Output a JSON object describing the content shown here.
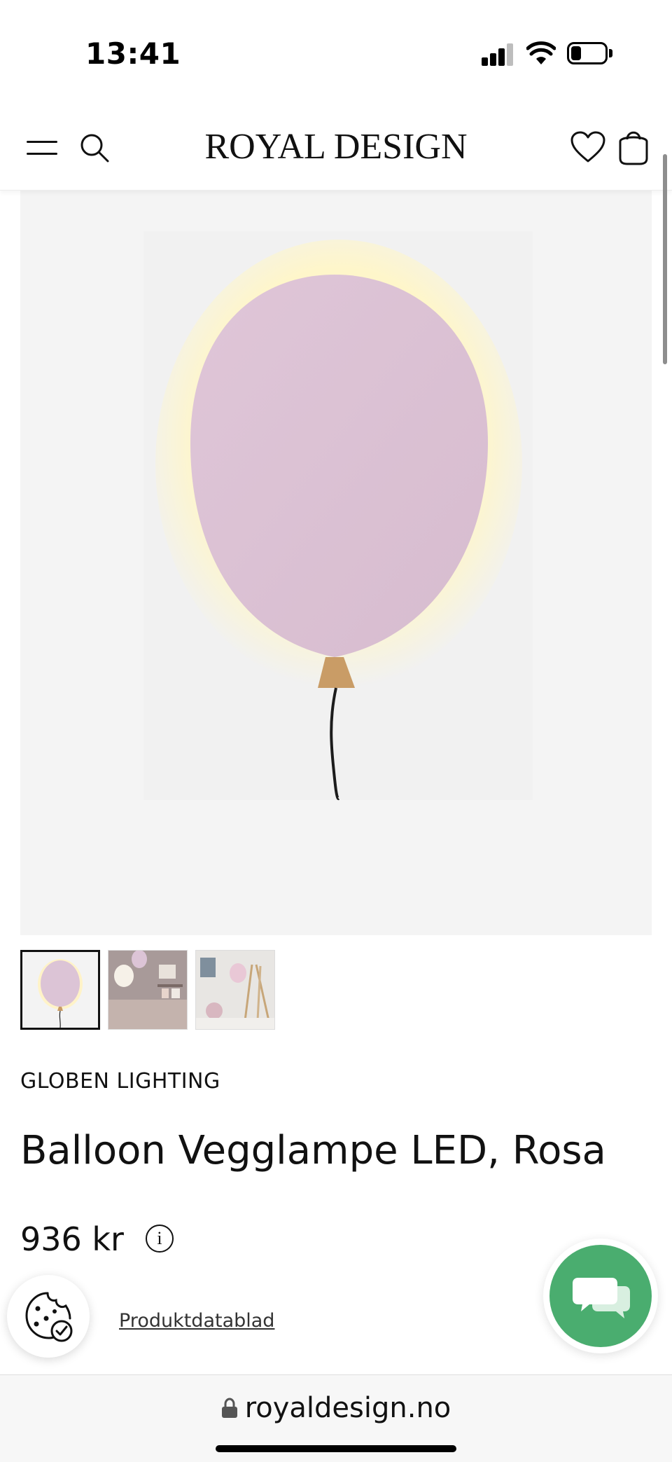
{
  "status_bar": {
    "time": "13:41",
    "icons": [
      "cellular-signal-icon",
      "wifi-icon",
      "battery-icon"
    ]
  },
  "header": {
    "logo": "ROYAL DESIGN",
    "icons": [
      "menu-icon",
      "search-icon",
      "heart-icon",
      "shopping-bag-icon"
    ]
  },
  "product": {
    "brand": "GLOBEN LIGHTING",
    "title": "Balloon Vegglampe LED, Rosa",
    "price": "936 kr",
    "datasheet_link": "Produktdatablad",
    "thumbnails": [
      "product-photo",
      "lifestyle-photo-1",
      "lifestyle-photo-2"
    ],
    "selected_thumbnail": 0
  },
  "colors": {
    "balloon_pink": "#dcc4d6",
    "chat_green": "#4aad6f",
    "image_bg": "#f4f4f4"
  },
  "browser": {
    "url": "royaldesign.no"
  }
}
